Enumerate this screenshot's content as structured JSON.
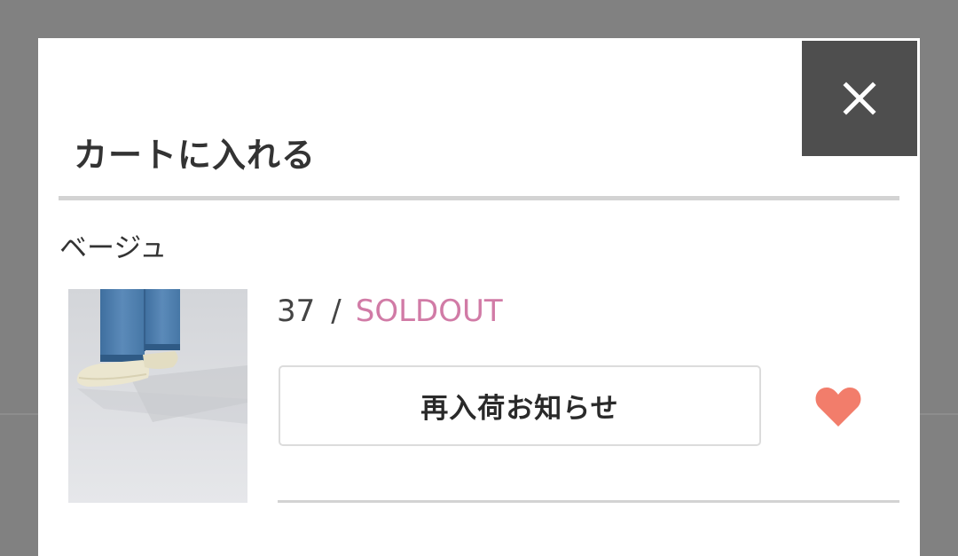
{
  "modal": {
    "title": "カートに入れる",
    "close_icon": "close-icon"
  },
  "variant": {
    "color_label": "ベージュ",
    "items": [
      {
        "size": "37",
        "separator": "/",
        "status": "SOLDOUT",
        "restock_button_label": "再入荷お知らせ",
        "favorite_icon": "heart-icon"
      }
    ]
  },
  "colors": {
    "overlay": "#818181",
    "close_button_bg": "#4e4e4e",
    "soldout_text": "#d17ba6",
    "heart": "#f27d6b",
    "divider": "#d3d3d3"
  }
}
